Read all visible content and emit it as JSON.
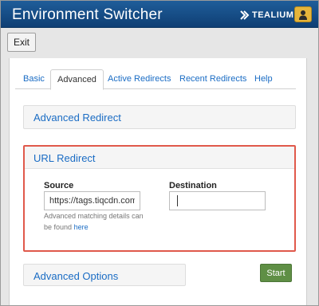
{
  "app": {
    "title": "Environment Switcher",
    "brand": "TEALIUM"
  },
  "toolbar": {
    "exit_label": "Exit"
  },
  "tabs": [
    {
      "label": "Basic",
      "active": false
    },
    {
      "label": "Advanced",
      "active": true
    },
    {
      "label": "Active Redirects",
      "active": false
    },
    {
      "label": "Recent Redirects",
      "active": false
    },
    {
      "label": "Help",
      "active": false
    }
  ],
  "advanced_redirect": {
    "title": "Advanced Redirect"
  },
  "url_redirect": {
    "title": "URL Redirect",
    "source_label": "Source",
    "source_value": "https://tags.tiqcdn.com",
    "help_text": "Advanced matching details can be found",
    "help_link": "here",
    "destination_label": "Destination",
    "destination_value": ""
  },
  "advanced_options": {
    "title": "Advanced Options"
  },
  "actions": {
    "start_label": "Start"
  },
  "colors": {
    "title_bar": "#0f3f74",
    "link": "#1a6cc4",
    "highlight": "#e0594b",
    "start": "#5f8f45",
    "user": "#e6b53b"
  }
}
